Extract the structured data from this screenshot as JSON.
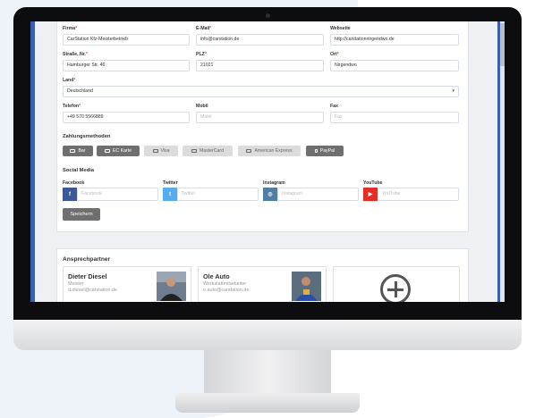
{
  "form": {
    "firma": {
      "label": "Firma",
      "value": "CarStation Kfz-Meisterbetrieb"
    },
    "email": {
      "label": "E-Mail",
      "value": "info@carstation.de"
    },
    "website": {
      "label": "Webseite",
      "value": "http://carstationnirgendwo.de"
    },
    "strasse": {
      "label": "Straße, Nr.",
      "value": "Hamburger Str. 46"
    },
    "plz": {
      "label": "PLZ",
      "value": "21021"
    },
    "ort": {
      "label": "Ort",
      "value": "Nirgendwo"
    },
    "land": {
      "label": "Land",
      "value": "Deutschland"
    },
    "telefon": {
      "label": "Telefon",
      "value": "+49 570 5566889"
    },
    "mobil": {
      "label": "Mobil",
      "placeholder": "Mobil"
    },
    "fax": {
      "label": "Fax",
      "placeholder": "Fax"
    }
  },
  "payment": {
    "title": "Zahlungsmethoden",
    "methods": [
      {
        "label": "Bar",
        "active": true
      },
      {
        "label": "EC Karte",
        "active": true
      },
      {
        "label": "Visa",
        "active": false
      },
      {
        "label": "MasterCard",
        "active": false
      },
      {
        "label": "American Express",
        "active": false
      },
      {
        "label": "PayPal",
        "active": true
      }
    ]
  },
  "social": {
    "title": "Social Media",
    "networks": [
      {
        "label": "Facebook",
        "placeholder": "Facebook",
        "icon": "facebook-icon",
        "color": "#3b5998"
      },
      {
        "label": "Twitter",
        "placeholder": "Twitter",
        "icon": "twitter-icon",
        "color": "#55acee"
      },
      {
        "label": "Instagram",
        "placeholder": "Instagram",
        "icon": "instagram-icon",
        "color": "#517fa4"
      },
      {
        "label": "YouTube",
        "placeholder": "YouTube",
        "icon": "youtube-icon",
        "color": "#e52d27"
      }
    ]
  },
  "save_label": "Speichern",
  "contacts": {
    "title": "Ansprechpartner",
    "items": [
      {
        "name": "Dieter Diesel",
        "role": "Meister",
        "email": "d.diesel@carstation.de"
      },
      {
        "name": "Ole Auto",
        "role": "Werkstattmitarbeiter",
        "email": "o.auto@carstation.de"
      }
    ]
  }
}
